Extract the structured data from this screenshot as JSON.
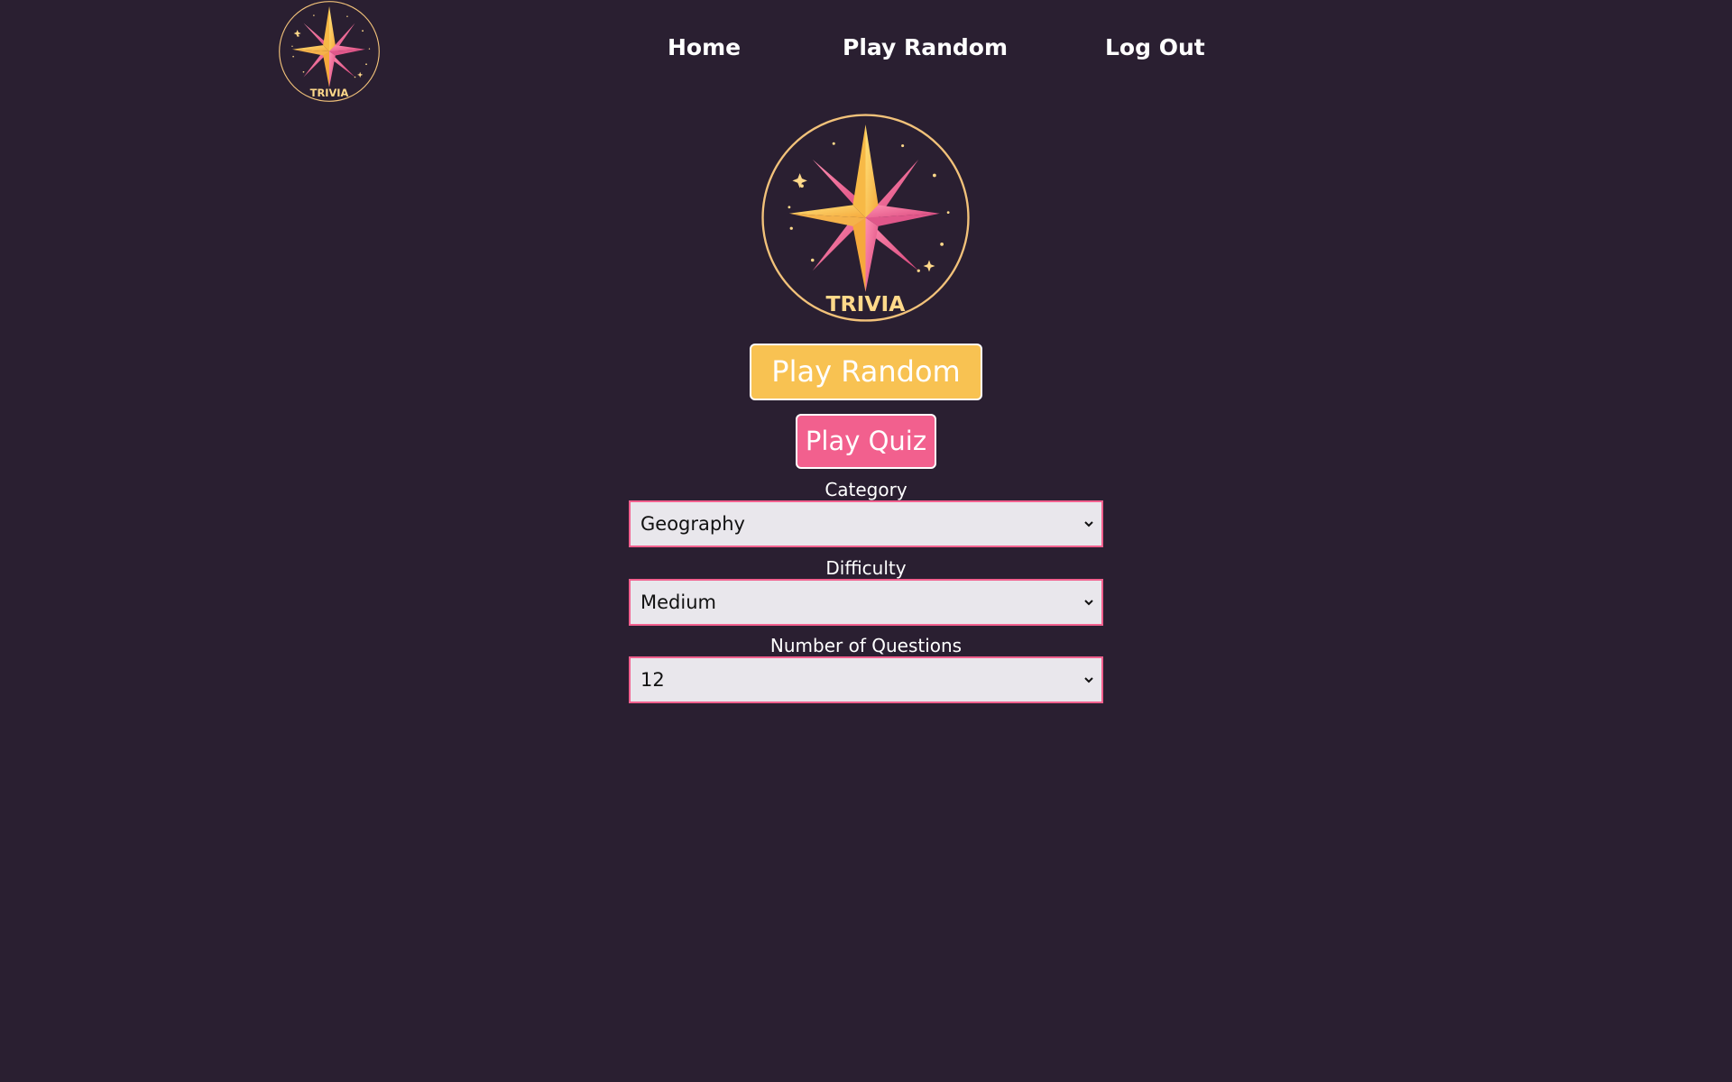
{
  "nav": {
    "logo_text": "TRIVIA",
    "home_label": "Home",
    "play_random_label": "Play Random",
    "logout_label": "Log Out"
  },
  "hero": {
    "logo_text": "TRIVIA"
  },
  "actions": {
    "play_random_label": "Play Random",
    "play_quiz_label": "Play Quiz"
  },
  "form": {
    "category": {
      "label": "Category",
      "value": "Geography"
    },
    "difficulty": {
      "label": "Difficulty",
      "value": "Medium"
    },
    "number": {
      "label": "Number of Questions",
      "value": "12"
    }
  },
  "colors": {
    "background": "#2a1f31",
    "accent_yellow": "#f8c252",
    "accent_pink": "#f2608e",
    "select_bg": "#e9e7ec"
  },
  "icons": {
    "logo": "trivia-star-logo-icon",
    "select_chevron": "chevron-down-icon"
  }
}
